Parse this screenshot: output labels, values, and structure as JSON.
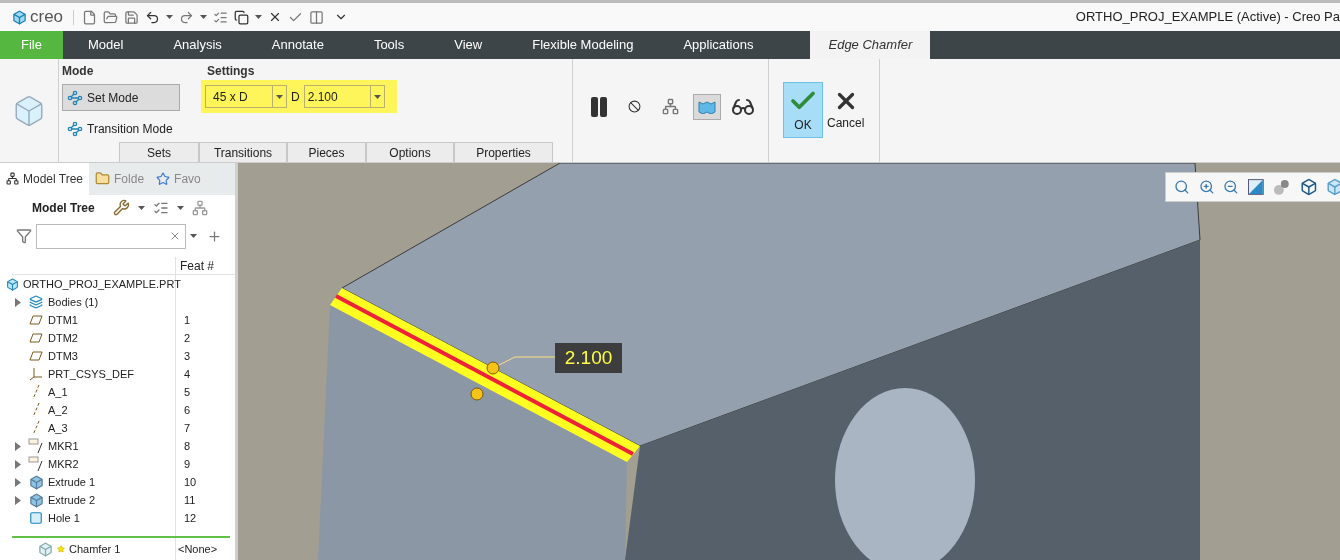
{
  "title_bar": {
    "logo": "creo",
    "title": "ORTHO_PROJ_EXAMPLE (Active) - Creo Pa"
  },
  "menu_tabs": [
    {
      "label": "File",
      "kind": "file",
      "selected": false
    },
    {
      "label": "Model",
      "kind": "tab",
      "selected": false
    },
    {
      "label": "Analysis",
      "kind": "tab",
      "selected": false
    },
    {
      "label": "Annotate",
      "kind": "tab",
      "selected": false
    },
    {
      "label": "Tools",
      "kind": "tab",
      "selected": false
    },
    {
      "label": "View",
      "kind": "tab",
      "selected": false
    },
    {
      "label": "Flexible Modeling",
      "kind": "tab",
      "selected": false
    },
    {
      "label": "Applications",
      "kind": "tab",
      "selected": false
    },
    {
      "label": "Edge Chamfer",
      "kind": "context",
      "selected": true
    }
  ],
  "ribbon": {
    "mode_group": {
      "title": "Mode",
      "modes": [
        {
          "label": "Set Mode",
          "selected": true
        },
        {
          "label": "Transition Mode",
          "selected": false
        }
      ]
    },
    "settings_group": {
      "title": "Settings",
      "highlighted": true,
      "type_dropdown": "45 x D",
      "d_label": "D",
      "d_value": "2.100"
    },
    "sub_tabs": [
      "Sets",
      "Transitions",
      "Pieces",
      "Options",
      "Properties"
    ],
    "tool_buttons": [
      {
        "kind": "pause",
        "pressed": false
      },
      {
        "kind": "no-entry",
        "pressed": false
      },
      {
        "kind": "preview",
        "pressed": false
      },
      {
        "kind": "verify",
        "pressed": true
      },
      {
        "kind": "glasses",
        "pressed": false
      }
    ],
    "ok": {
      "label": "OK",
      "pressed": true
    },
    "cancel": {
      "label": "Cancel"
    }
  },
  "model_tree": {
    "tabs": [
      {
        "label": "Model Tree",
        "selected": true
      },
      {
        "label": "Folde",
        "selected": false
      },
      {
        "label": "Favo",
        "selected": false
      }
    ],
    "header": "Model Tree",
    "feat_column": "Feat #",
    "items": [
      {
        "name": "ORTHO_PROJ_EXAMPLE.PRT",
        "kind": "part",
        "has_children": false
      },
      {
        "name": "Bodies (1)",
        "kind": "bodies",
        "has_children": true
      },
      {
        "name": "DTM1",
        "kind": "datum-plane",
        "has_children": false,
        "feat": "1"
      },
      {
        "name": "DTM2",
        "kind": "datum-plane",
        "has_children": false,
        "feat": "2"
      },
      {
        "name": "DTM3",
        "kind": "datum-plane",
        "has_children": false,
        "feat": "3"
      },
      {
        "name": "PRT_CSYS_DEF",
        "kind": "csys",
        "has_children": false,
        "feat": "4"
      },
      {
        "name": "A_1",
        "kind": "axis",
        "has_children": false,
        "feat": "5"
      },
      {
        "name": "A_2",
        "kind": "axis",
        "has_children": false,
        "feat": "6"
      },
      {
        "name": "A_3",
        "kind": "axis",
        "has_children": false,
        "feat": "7"
      },
      {
        "name": "MKR1",
        "kind": "marker",
        "has_children": true,
        "feat": "8"
      },
      {
        "name": "MKR2",
        "kind": "marker",
        "has_children": true,
        "feat": "9"
      },
      {
        "name": "Extrude 1",
        "kind": "extrude",
        "has_children": true,
        "feat": "10"
      },
      {
        "name": "Extrude 2",
        "kind": "extrude",
        "has_children": true,
        "feat": "11"
      },
      {
        "name": "Hole 1",
        "kind": "hole",
        "has_children": false,
        "feat": "12"
      }
    ],
    "new_feature": {
      "name": "Chamfer 1",
      "feat": "<None>"
    }
  },
  "viewport": {
    "dimension": "2.100"
  }
}
